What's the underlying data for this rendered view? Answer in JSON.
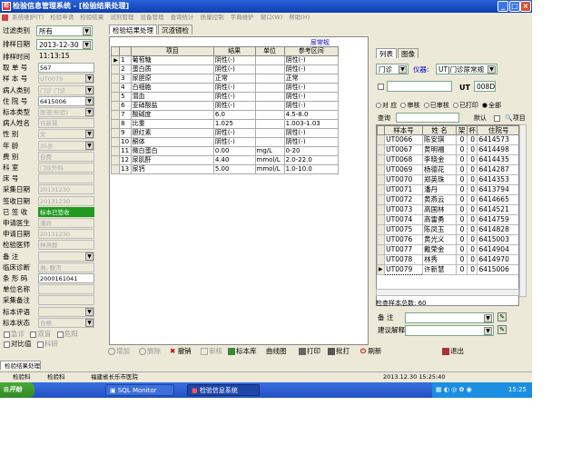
{
  "window": {
    "title": "检验信息管理系统 - [检验结果处理]"
  },
  "menu": [
    "系统维护(T)",
    "检验申请",
    "检验结果",
    "试剂管理",
    "设备管理",
    "查询统计",
    "质量控制",
    "字典维护",
    "窗口(W)",
    "帮助(H)"
  ],
  "filters": {
    "type_label": "过滤类别",
    "type_value": "所有",
    "date_label": "排样日期",
    "date_value": "2013-12-30"
  },
  "fields": [
    {
      "label": "排样时间",
      "value": "11:13:15",
      "style": "plain"
    },
    {
      "label": "取 单 号",
      "value": "567",
      "style": "white"
    },
    {
      "label": "样 本 号",
      "value": "UT0079",
      "style": "dis",
      "dd": true
    },
    {
      "label": "病人类别",
      "value": "门诊 门诊",
      "style": "dis",
      "dd": true
    },
    {
      "label": "住 院 号",
      "value": "6415006",
      "style": "white",
      "dd": true
    },
    {
      "label": "标本类型",
      "value": "尿液(检验)",
      "style": "dis",
      "dd": true
    },
    {
      "label": "病人姓名",
      "value": "许新慧",
      "style": "dis"
    },
    {
      "label": "性    别",
      "value": "女",
      "style": "dis",
      "dd": true
    },
    {
      "label": "年    龄",
      "value": "35岁",
      "style": "dis",
      "dd": true
    },
    {
      "label": "费    别",
      "value": "自费",
      "style": "dis"
    },
    {
      "label": "科    室",
      "value": "门诊外科",
      "style": "dis"
    },
    {
      "label": "床    号",
      "value": "",
      "style": "dis"
    },
    {
      "label": "采集日期",
      "value": "20131230",
      "style": "dis"
    },
    {
      "label": "签收日期",
      "value": "20131230",
      "style": "dis"
    },
    {
      "label": "已 签 收",
      "value": "标本已签收",
      "style": "green"
    },
    {
      "label": "申请医生",
      "value": "潘尚",
      "style": "dis"
    },
    {
      "label": "申请日期",
      "value": "20131230",
      "style": "dis"
    },
    {
      "label": "检验医师",
      "value": "林燕群",
      "style": "dis"
    },
    {
      "label": "备    注",
      "value": "",
      "style": "dis",
      "dd": true
    },
    {
      "label": "临床诊断",
      "value": "淋, 腹泻",
      "style": "dis"
    },
    {
      "label": "条 形 码",
      "value": "2000161041",
      "style": "white"
    },
    {
      "label": "单位名称",
      "value": "",
      "style": "dis"
    },
    {
      "label": "采集备注",
      "value": "",
      "style": "dis"
    },
    {
      "label": "标本评语",
      "value": "",
      "style": "dis",
      "dd": true
    },
    {
      "label": "标本状态",
      "value": "合格",
      "style": "dis",
      "dd": true
    }
  ],
  "checkboxes": {
    "c1": "急诊",
    "c2": "双盲",
    "c3": "危阳",
    "c4": "对比值",
    "c5": "科研"
  },
  "center": {
    "tab_results": "检验结果处理",
    "tab_sediment": "沉渣镜检",
    "subtitle": "尿常规",
    "headers": [
      "项目",
      "结果",
      "单位",
      "参考区间"
    ],
    "rows": [
      [
        "1",
        "葡萄糖",
        "阴性(-)",
        "",
        "阴性(-)"
      ],
      [
        "2",
        "蛋白质",
        "阴性(-)",
        "",
        "阴性(-)"
      ],
      [
        "3",
        "尿胆原",
        "正常",
        "",
        "正常"
      ],
      [
        "4",
        "白细胞",
        "阴性(-)",
        "",
        "阴性(-)"
      ],
      [
        "5",
        "潜血",
        "阴性(-)",
        "",
        "阴性(-)"
      ],
      [
        "6",
        "亚硝酸盐",
        "阴性(-)",
        "",
        "阴性(-)"
      ],
      [
        "7",
        "酸碱度",
        "6.0",
        "",
        "4.5-8.0"
      ],
      [
        "8",
        "比重",
        "1.025",
        "",
        "1.003-1.03"
      ],
      [
        "9",
        "胆红素",
        "阴性(-)",
        "",
        "阴性(-)"
      ],
      [
        "10",
        "酮体",
        "阴性(-)",
        "",
        "阴性(-)"
      ],
      [
        "11",
        "微白蛋白",
        "0.00",
        "mg/L",
        "0-20"
      ],
      [
        "12",
        "尿肌酐",
        "4.40",
        "mmol/L",
        "2.0-22.0"
      ],
      [
        "13",
        "尿钙",
        "5.00",
        "mmol/L",
        "1.0-10.0"
      ]
    ]
  },
  "right": {
    "tab_list": "列表",
    "tab_image": "图像",
    "clinic_value": "门诊",
    "instrument_label": "仪器:",
    "instrument_value": "UT|门诊尿常规",
    "ut_label": "UT",
    "ut_value": "008D",
    "radio_opts": [
      "对",
      "应",
      "审核",
      "已审核",
      "已打印",
      "全部"
    ],
    "query_label": "查询",
    "default_label": "默认",
    "item_label": "项目",
    "headers": [
      "样本号",
      "姓 名",
      "架",
      "杯",
      "住院号"
    ],
    "rows": [
      [
        "UT0066",
        "陈安琪",
        "0",
        "0",
        "6414573"
      ],
      [
        "UT0067",
        "黄明福",
        "0",
        "0",
        "6414498"
      ],
      [
        "UT0068",
        "李晓金",
        "0",
        "0",
        "6414435"
      ],
      [
        "UT0069",
        "杨德花",
        "0",
        "0",
        "6414287"
      ],
      [
        "UT0070",
        "郑英珠",
        "0",
        "0",
        "6414353"
      ],
      [
        "UT0071",
        "潘丹",
        "0",
        "0",
        "6413794"
      ],
      [
        "UT0072",
        "黄燕云",
        "0",
        "0",
        "6414665"
      ],
      [
        "UT0073",
        "高国林",
        "0",
        "0",
        "6414521"
      ],
      [
        "UT0074",
        "高雷勇",
        "0",
        "0",
        "6414759"
      ],
      [
        "UT0075",
        "陈凤玉",
        "0",
        "0",
        "6414828"
      ],
      [
        "UT0076",
        "黄光义",
        "0",
        "0",
        "6415003"
      ],
      [
        "UT0077",
        "戴荣金",
        "0",
        "0",
        "6414904"
      ],
      [
        "UT0078",
        "林秀",
        "0",
        "0",
        "6414970"
      ],
      [
        "UT0079",
        "许新慧",
        "0",
        "0",
        "6415006"
      ]
    ],
    "count_text": "检查样本总数: 60",
    "note_label": "备  注",
    "suggest_label": "建议解释"
  },
  "toolbar": {
    "add": "增加",
    "delete": "删除",
    "revoke": "撤销",
    "audit": "审核",
    "sample_lib": "标本库",
    "curve": "曲线图",
    "print": "打印",
    "batch_print": "批打",
    "refresh": "刷新",
    "exit": "退出"
  },
  "statusbar": {
    "tab": "检验结果处理",
    "dept": "检验科",
    "user": "检验科",
    "hospital": "福建省长乐市医院",
    "datetime": "2013.12.30 15:25:40"
  },
  "taskbar": {
    "start": "开始",
    "task1": "SQL Monitor",
    "task2": "检验信息系统",
    "clock": "15:25"
  },
  "colors": {
    "titlebar": "#0d3fb0",
    "signed": "#1f9a1f",
    "selection": "#000080"
  }
}
